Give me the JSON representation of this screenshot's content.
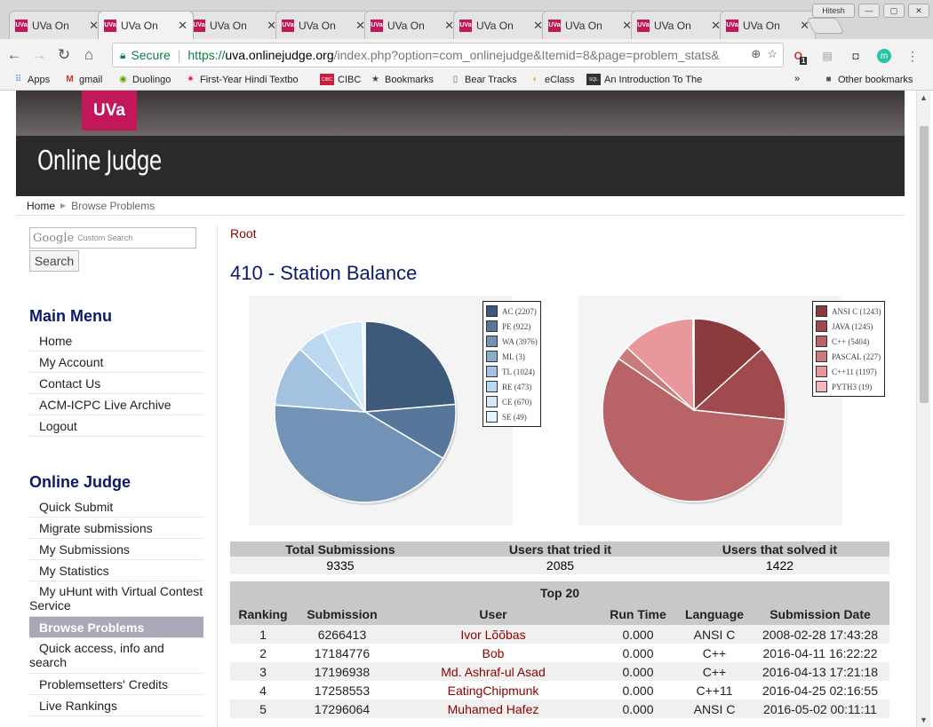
{
  "browser": {
    "tabs": [
      {
        "label": "UVa On"
      },
      {
        "label": "UVa On"
      },
      {
        "label": "UVa On"
      },
      {
        "label": "UVa On"
      },
      {
        "label": "UVa On"
      },
      {
        "label": "UVa On"
      },
      {
        "label": "UVa On"
      },
      {
        "label": "UVa On"
      },
      {
        "label": "UVa On"
      }
    ],
    "tab_icon_text": "UVa",
    "profile_label": "Hitesh",
    "secure_label": "Secure",
    "url_scheme": "https://",
    "url_host": "uva.onlinejudge.org",
    "url_path": "/index.php?option=com_onlinejudge&Itemid=8&page=problem_stats&",
    "ext_badge": "1",
    "ext_m": "m",
    "bookmarks": [
      {
        "label": "Apps"
      },
      {
        "label": "gmail"
      },
      {
        "label": "Duolingo"
      },
      {
        "label": "First-Year Hindi Textbo"
      },
      {
        "label": "CIBC"
      },
      {
        "label": "Bookmarks"
      },
      {
        "label": "Bear Tracks"
      },
      {
        "label": "eClass"
      },
      {
        "label": "An Introduction To The"
      }
    ],
    "bookmarks_overflow": "»",
    "other_bookmarks": "Other bookmarks",
    "cibc_icon": "CIBC",
    "sql_icon": "SQL"
  },
  "site": {
    "logo": "UVa",
    "title": "Online Judge",
    "breadcrumb": {
      "home": "Home",
      "current": "Browse Problems"
    },
    "search": {
      "google": "Google",
      "custom": "Custom Search",
      "button": "Search"
    }
  },
  "sidebar": {
    "main_menu_title": "Main Menu",
    "main_menu": [
      {
        "label": "Home"
      },
      {
        "label": "My Account"
      },
      {
        "label": "Contact Us"
      },
      {
        "label": "ACM-ICPC Live Archive"
      },
      {
        "label": "Logout"
      }
    ],
    "oj_title": "Online Judge",
    "oj_menu": [
      {
        "label": "Quick Submit"
      },
      {
        "label": "Migrate submissions"
      },
      {
        "label": "My Submissions"
      },
      {
        "label": "My Statistics"
      },
      {
        "label": "My uHunt with Virtual Contest Service"
      },
      {
        "label": "Browse Problems"
      },
      {
        "label": "Quick access, info and search"
      },
      {
        "label": "Problemsetters' Credits"
      },
      {
        "label": "Live Rankings"
      }
    ]
  },
  "content": {
    "root_link": "Root",
    "problem_title": "410 - Station Balance",
    "stats": {
      "headers": [
        "Total Submissions",
        "Users that tried it",
        "Users that solved it"
      ],
      "values": [
        "9335",
        "2085",
        "1422"
      ]
    },
    "top": {
      "caption": "Top 20",
      "headers": [
        "Ranking",
        "Submission",
        "User",
        "Run Time",
        "Language",
        "Submission Date"
      ],
      "rows": [
        [
          "1",
          "6266413",
          "Ivor Lõõbas",
          "0.000",
          "ANSI C",
          "2008-02-28 17:43:28"
        ],
        [
          "2",
          "17184776",
          "Bob",
          "0.000",
          "C++",
          "2016-04-11 16:22:22"
        ],
        [
          "3",
          "17196938",
          "Md. Ashraf-ul Asad",
          "0.000",
          "C++",
          "2016-04-13 17:21:18"
        ],
        [
          "4",
          "17258553",
          "EatingChipmunk",
          "0.000",
          "C++11",
          "2016-04-25 02:16:55"
        ],
        [
          "5",
          "17296064",
          "Muhamed Hafez",
          "0.000",
          "ANSI C",
          "2016-05-02 00:11:11"
        ]
      ]
    }
  },
  "chart_data": [
    {
      "type": "pie",
      "title": "",
      "categories": [
        "AC",
        "PE",
        "WA",
        "ML",
        "TL",
        "RE",
        "CE",
        "SE"
      ],
      "values": [
        2207,
        922,
        3976,
        3,
        1024,
        473,
        670,
        49
      ],
      "legend_labels": [
        "AC (2207)",
        "PE (922)",
        "WA (3976)",
        "ML (3)",
        "TL (1024)",
        "RE (473)",
        "CE (670)",
        "SE (49)"
      ],
      "colors": [
        "#3d5a7a",
        "#58769a",
        "#7393b6",
        "#8aaccc",
        "#a3c2e0",
        "#bcd8f0",
        "#d2e9fa",
        "#e6f5ff"
      ],
      "legend_placement": "right"
    },
    {
      "type": "pie",
      "title": "",
      "categories": [
        "ANSI C",
        "JAVA",
        "C++",
        "PASCAL",
        "C++11",
        "PYTH3"
      ],
      "values": [
        1243,
        1245,
        5404,
        227,
        1197,
        19
      ],
      "legend_labels": [
        "ANSI C (1243)",
        "JAVA (1245)",
        "C++ (5404)",
        "PASCAL (227)",
        "C++11 (1197)",
        "PYTH3 (19)"
      ],
      "colors": [
        "#8b3a3e",
        "#a04a4e",
        "#b86467",
        "#c97a7d",
        "#e8979a",
        "#f6b8ba"
      ],
      "legend_placement": "right"
    }
  ]
}
